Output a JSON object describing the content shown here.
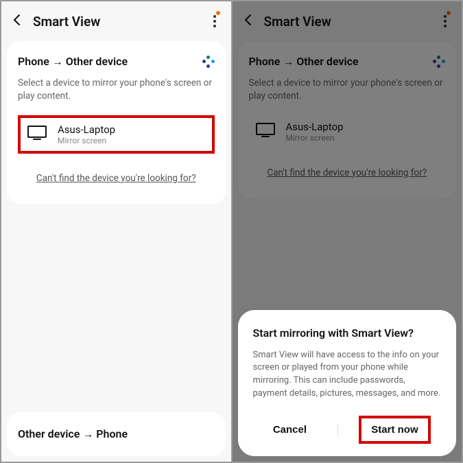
{
  "left": {
    "header_title": "Smart View",
    "mode_title": "Phone → Other device",
    "subtitle": "Select a device to mirror your phone's screen or play content.",
    "device": {
      "name": "Asus-Laptop",
      "sub": "Mirror screen"
    },
    "help_link": "Can't find the device you're looking for?",
    "bottom_title": "Other device → Phone"
  },
  "right": {
    "header_title": "Smart View",
    "mode_title": "Phone → Other device",
    "subtitle": "Select a device to mirror your phone's screen or play content.",
    "device": {
      "name": "Asus-Laptop",
      "sub": "Mirror screen"
    },
    "help_link": "Can't find the device you're looking for?",
    "dialog": {
      "title": "Start mirroring with Smart View?",
      "body": "Smart View will have access to the info on your screen or played from your phone while mirroring. This can include passwords, payment details, pictures, messages, and more.",
      "cancel": "Cancel",
      "confirm": "Start now"
    }
  }
}
